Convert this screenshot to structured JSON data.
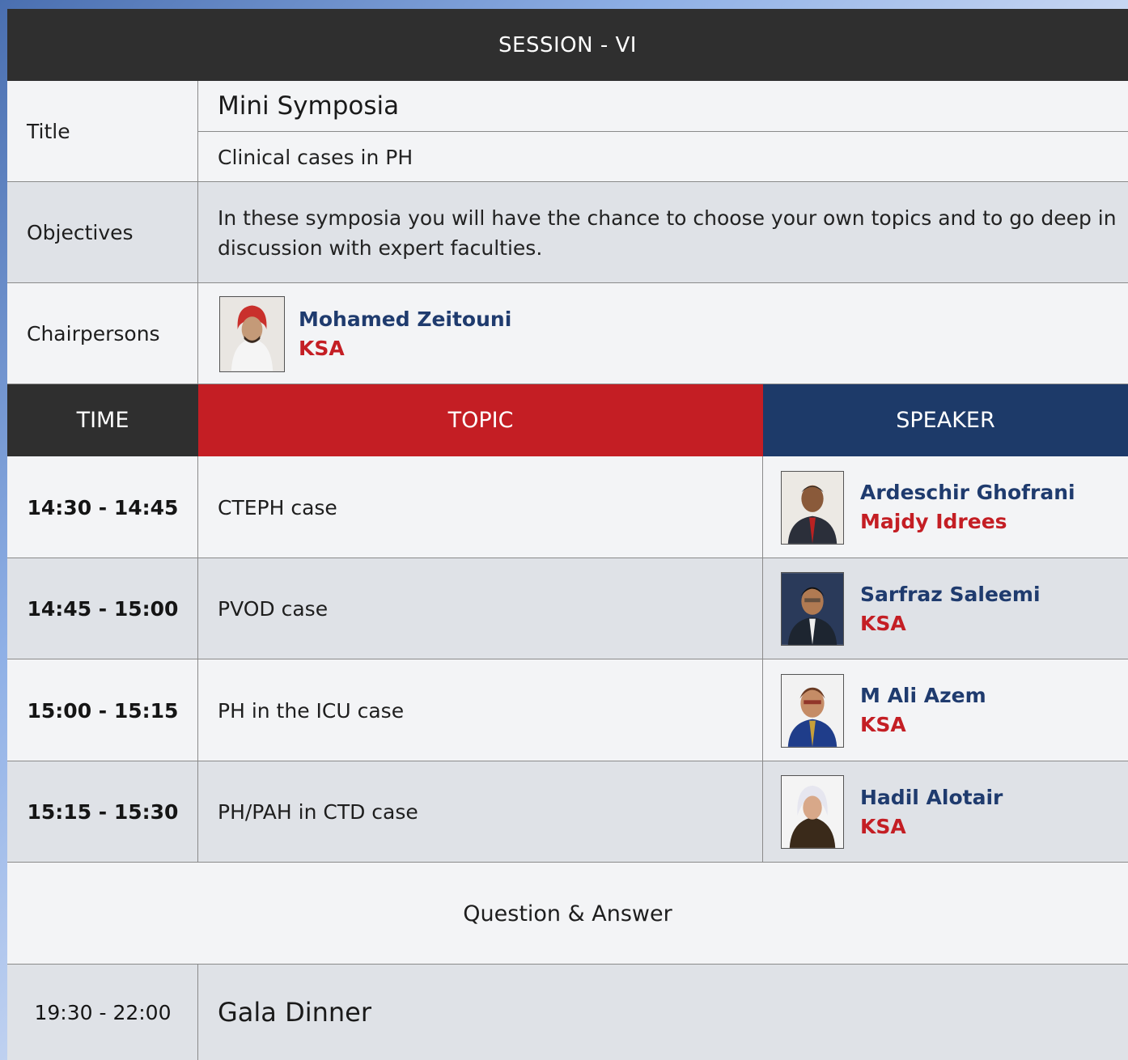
{
  "session": {
    "title": "SESSION - VI"
  },
  "info": {
    "title_label": "Title",
    "title_main": "Mini Symposia",
    "title_sub": "Clinical cases in PH",
    "objectives_label": "Objectives",
    "objectives_text": "In these symposia you will have the chance to choose your own topics and to go deep in discussion with expert faculties.",
    "chair_label": "Chairpersons",
    "chair": {
      "name": "Mohamed Zeitouni",
      "country": "KSA"
    }
  },
  "table_headers": {
    "time": "TIME",
    "topic": "TOPIC",
    "speaker": "SPEAKER"
  },
  "rows": [
    {
      "time": "14:30 - 14:45",
      "topic": "CTEPH case",
      "speaker": "Ardeschir Ghofrani",
      "sub": "Majdy Idrees"
    },
    {
      "time": "14:45 - 15:00",
      "topic": "PVOD case",
      "speaker": "Sarfraz Saleemi",
      "sub": "KSA"
    },
    {
      "time": "15:00 - 15:15",
      "topic": "PH in the ICU case",
      "speaker": "M Ali Azem",
      "sub": "KSA"
    },
    {
      "time": "15:15 - 15:30",
      "topic": "PH/PAH in CTD case",
      "speaker": "Hadil Alotair",
      "sub": "KSA"
    }
  ],
  "qa": {
    "label": "Question & Answer"
  },
  "dinner": {
    "time": "19:30 - 22:00",
    "label": "Gala Dinner"
  },
  "colors": {
    "dark": "#2f2f2f",
    "topic_red": "#c41e24",
    "speaker_blue": "#1f3b6e"
  }
}
